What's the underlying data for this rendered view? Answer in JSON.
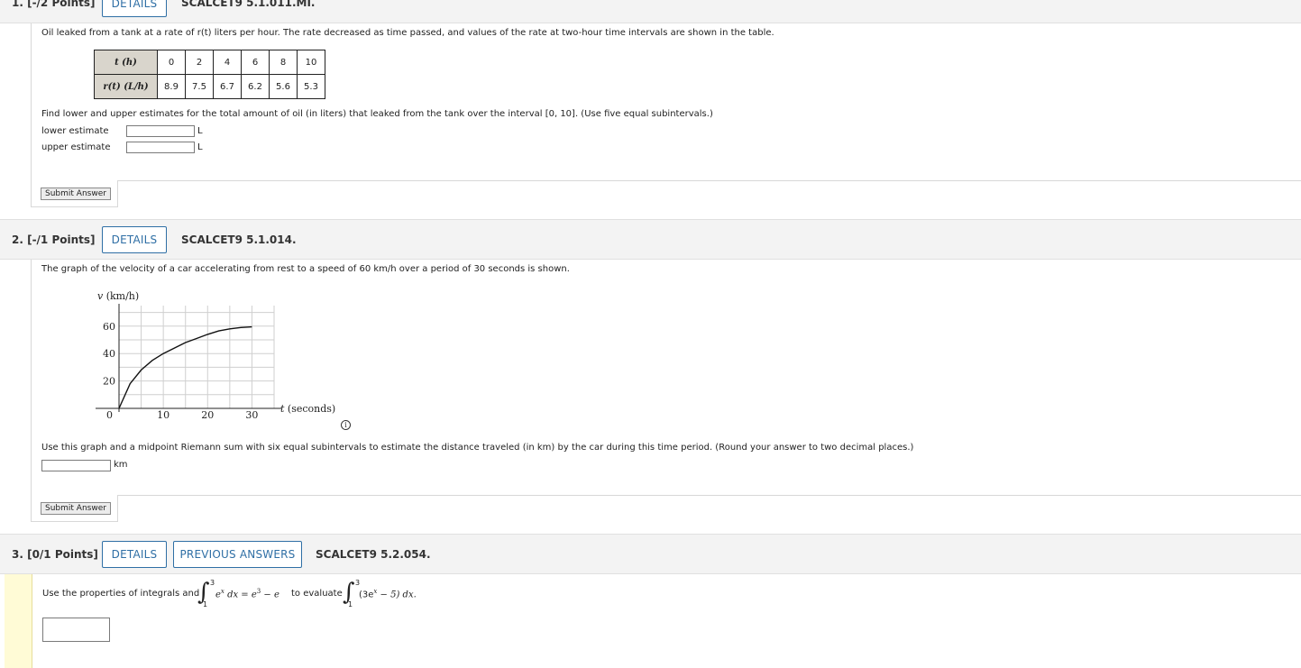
{
  "q1": {
    "number": "1. [-/2 Points]",
    "details_label": "DETAILS",
    "code": "SCALCET9 5.1.011.MI.",
    "intro": "Oil leaked from a tank at a rate of r(t) liters per hour. The rate decreased as time passed, and values of the rate at two-hour time intervals are shown in the table.",
    "table": {
      "row1_header": "t (h)",
      "row1": [
        "0",
        "2",
        "4",
        "6",
        "8",
        "10"
      ],
      "row2_header": "r(t) (L/h)",
      "row2": [
        "8.9",
        "7.5",
        "6.7",
        "6.2",
        "5.6",
        "5.3"
      ]
    },
    "prompt": "Find lower and upper estimates for the total amount of oil (in liters) that leaked from the tank over the interval [0, 10]. (Use five equal subintervals.)",
    "lower_label": "lower estimate",
    "upper_label": "upper estimate",
    "lower_value": "",
    "upper_value": "",
    "unit": "L",
    "submit_label": "Submit Answer"
  },
  "q2": {
    "number": "2. [-/1 Points]",
    "details_label": "DETAILS",
    "code": "SCALCET9 5.1.014.",
    "intro": "The graph of the velocity of a car accelerating from rest to a speed of 60 km/h over a period of 30 seconds is shown.",
    "prompt": "Use this graph and a midpoint Riemann sum with six equal subintervals to estimate the distance traveled (in km) by the car during this time period. (Round your answer to two decimal places.)",
    "answer_value": "",
    "unit": "km",
    "submit_label": "Submit Answer",
    "info_icon": "info-icon"
  },
  "chart_data": {
    "type": "line",
    "ylabel": "v (km/h)",
    "xlabel": "t (seconds)",
    "xlim": [
      0,
      30
    ],
    "ylim": [
      0,
      60
    ],
    "x_ticks": [
      "10",
      "20",
      "30"
    ],
    "y_ticks": [
      "20",
      "40",
      "60"
    ],
    "origin_label": "0",
    "grid": true,
    "series": [
      {
        "x": [
          0,
          2.5,
          5,
          7.5,
          10,
          12.5,
          15,
          17.5,
          20,
          22.5,
          25,
          27.5,
          30
        ],
        "y": [
          0,
          18,
          28,
          35,
          40,
          44,
          48,
          51,
          54,
          56.5,
          58,
          59,
          59.5
        ]
      }
    ]
  },
  "q3": {
    "number": "3. [0/1 Points]",
    "details_label": "DETAILS",
    "prev_label": "PREVIOUS ANSWERS",
    "code": "SCALCET9 5.2.054.",
    "text_a": "Use the properties of integrals and",
    "int1_upper": "3",
    "int1_lower": "1",
    "int1_integrand": "e",
    "int1_exp": "x",
    "int1_dx": "dx = e",
    "int1_rhs_exp": "3",
    "int1_rhs_tail": " − e",
    "text_b": "to evaluate",
    "int2_upper": "3",
    "int2_lower": "1",
    "int2_integrand": "(3e",
    "int2_exp": "x",
    "int2_tail": " − 5) dx.",
    "answer_value": ""
  }
}
